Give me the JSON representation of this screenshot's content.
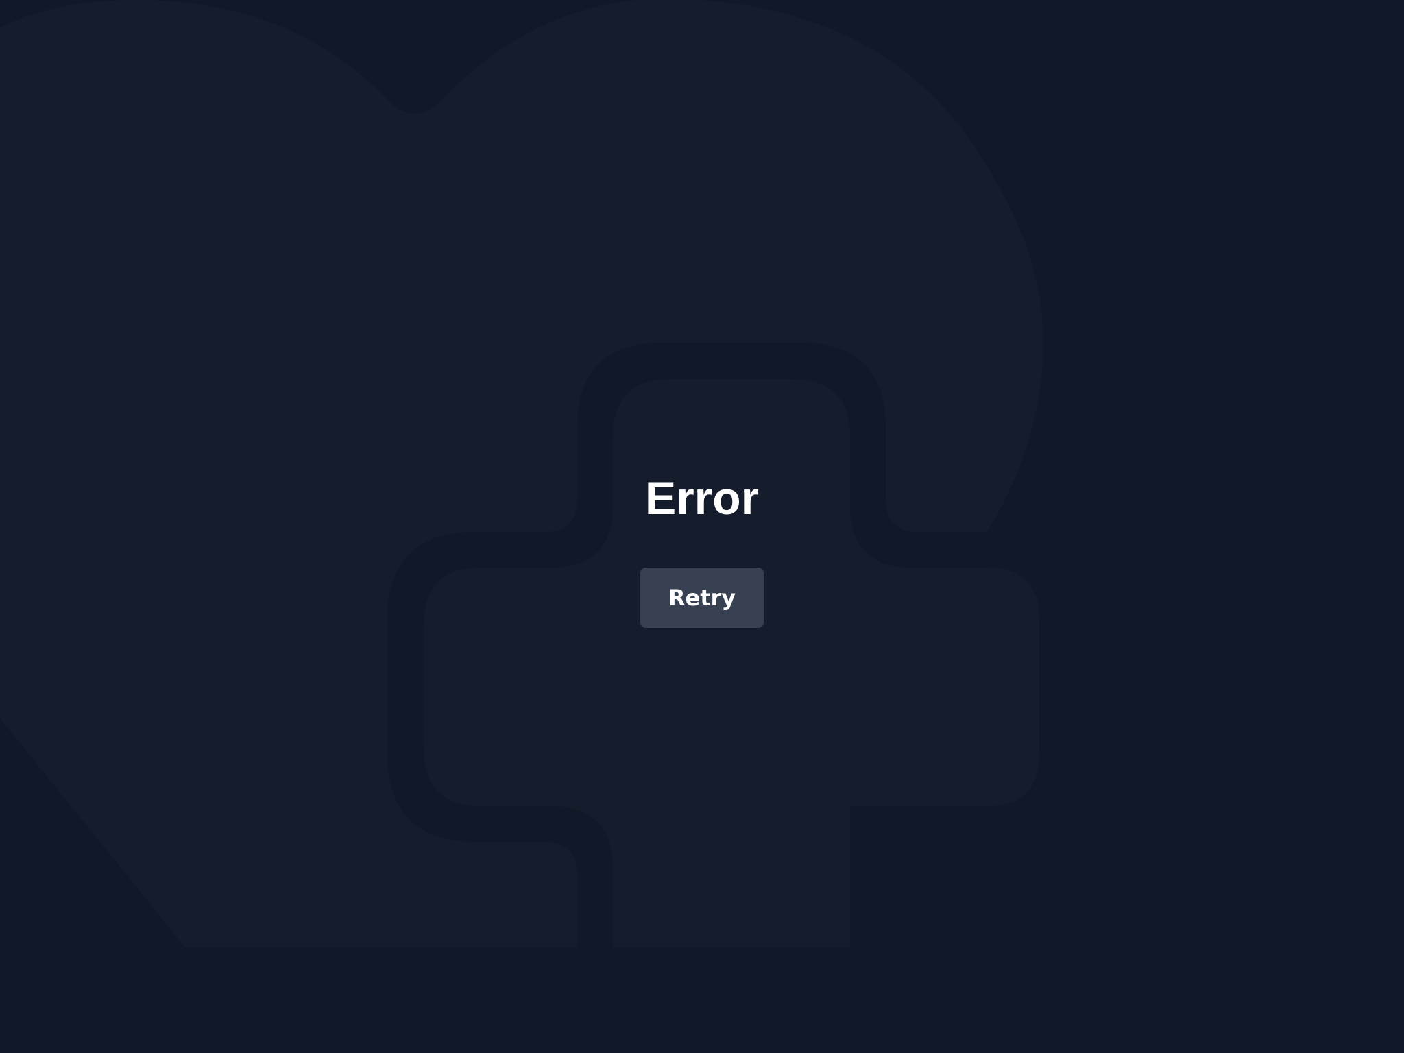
{
  "colors": {
    "background": "#111827",
    "illustration_fill": "#151c2b",
    "title_text": "#ffffff",
    "button_background": "#374151",
    "button_text": "#ffffff"
  },
  "illustration": {
    "icon": "broken-heart-puzzle-icon"
  },
  "error_page": {
    "title": "Error",
    "retry_label": "Retry"
  }
}
